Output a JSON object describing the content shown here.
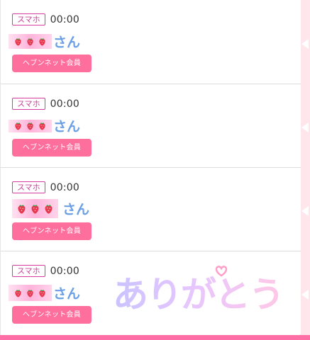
{
  "messages": [
    {
      "device": "スマホ",
      "time": "00:00",
      "honorific": "さん",
      "button": "ヘブンネット会員"
    },
    {
      "device": "スマホ",
      "time": "00:00",
      "honorific": "さん",
      "button": "ヘブンネット会員"
    },
    {
      "device": "スマホ",
      "time": "00:00",
      "honorific": "さん",
      "button": "ヘブンネット会員"
    },
    {
      "device": "スマホ",
      "time": "00:00",
      "honorific": "さん",
      "button": "ヘブンネット会員"
    }
  ],
  "stamp": {
    "text": "ありがとう"
  },
  "colors": {
    "accent_pink": "#ff6f9e",
    "tag_border": "#d63c9b",
    "honorific_blue": "#6b9fe6",
    "side_panel": "#ffe6ec",
    "bottom_bar": "#ff6fa6"
  },
  "icons": {
    "nickname_mark": "strawberry-icon",
    "side_marker": "triangle-left-icon"
  }
}
